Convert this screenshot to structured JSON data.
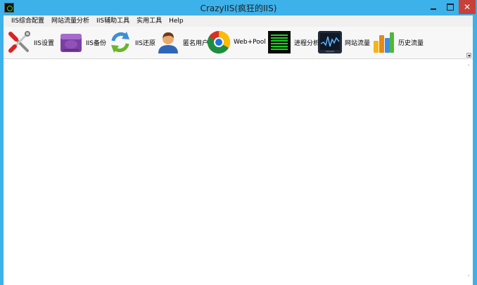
{
  "window": {
    "title": "CrazyIIS(疯狂的IIS)",
    "close_glyph": "✕"
  },
  "menu": [
    "IIS综合配置",
    "网站流量分析",
    "IIS辅助工具",
    "实用工具",
    "Help"
  ],
  "toolbar": {
    "items": [
      {
        "label": "IIS设置",
        "icon": "tools-icon"
      },
      {
        "label": "IIS备份",
        "icon": "drive-icon"
      },
      {
        "label": "IIS还原",
        "icon": "refresh-icon"
      },
      {
        "label": "匿名用户",
        "icon": "user-icon"
      },
      {
        "label": "Web+Pool",
        "icon": "chrome-icon"
      },
      {
        "label": "进程分析",
        "icon": "process-icon"
      },
      {
        "label": "网站流量",
        "icon": "traffic-chart-icon"
      },
      {
        "label": "历史流量",
        "icon": "bar-chart-icon"
      }
    ]
  },
  "scroll": {
    "up_glyph": "˄",
    "down_glyph": "˅"
  },
  "colors": {
    "frame": "#3cb1ea",
    "close": "#c7403a",
    "menubar": "#f0f0f0",
    "toolbar": "#f7f7f7"
  }
}
